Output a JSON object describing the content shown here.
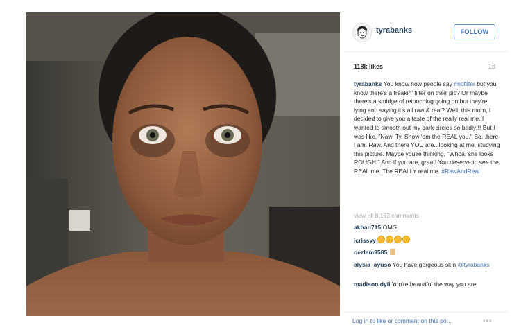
{
  "post": {
    "username": "tyrabanks",
    "follow_label": "FOLLOW",
    "likes": "118k likes",
    "age": "1d",
    "caption": {
      "username": "tyrabanks",
      "part1": " You know how people say ",
      "hashtag1": "#nofilter",
      "part2": " but you know there's a freakin' filter on their pic? Or maybe there's a smidge of retouching going on but they're lying and saying it's all raw & real? Well, this morn, I decided to give you a taste of the really real me. I wanted to smooth out my dark circles so badly!!! But I was like, \"Naw, Ty. Show 'em the REAL you.\" So...here I am. Raw. And there YOU are...looking at me, studying this picture. Maybe you're thinking, \"Whoa, she looks ROUGH.\" And if you are, great! You deserve to see the REAL me. The REALLY real me. ",
      "hashtag2": "#RawAndReal"
    },
    "view_all": "view all 8,163 comments",
    "comments": [
      {
        "user": "akhan715",
        "text": " OMG"
      },
      {
        "user": "icrissyy",
        "text": " "
      },
      {
        "user": "oezlem9585",
        "text": " "
      },
      {
        "user": "alysia_ayuso",
        "text": " You have gorgeous skin ",
        "mention": "@tyrabanks"
      },
      {
        "user": "madison.dyll",
        "text": " You're beautiful the way you are"
      }
    ],
    "login_prompt": "Log in to like or comment on this po...",
    "more_icon": "•••"
  },
  "colors": {
    "username": "#1c3c58",
    "link": "#3f72af",
    "muted": "#a5a7aa",
    "border": "#efefef"
  },
  "icons": [
    "avatar",
    "smiling-face-icon",
    "thumbs-up-icon",
    "more-options-icon"
  ]
}
